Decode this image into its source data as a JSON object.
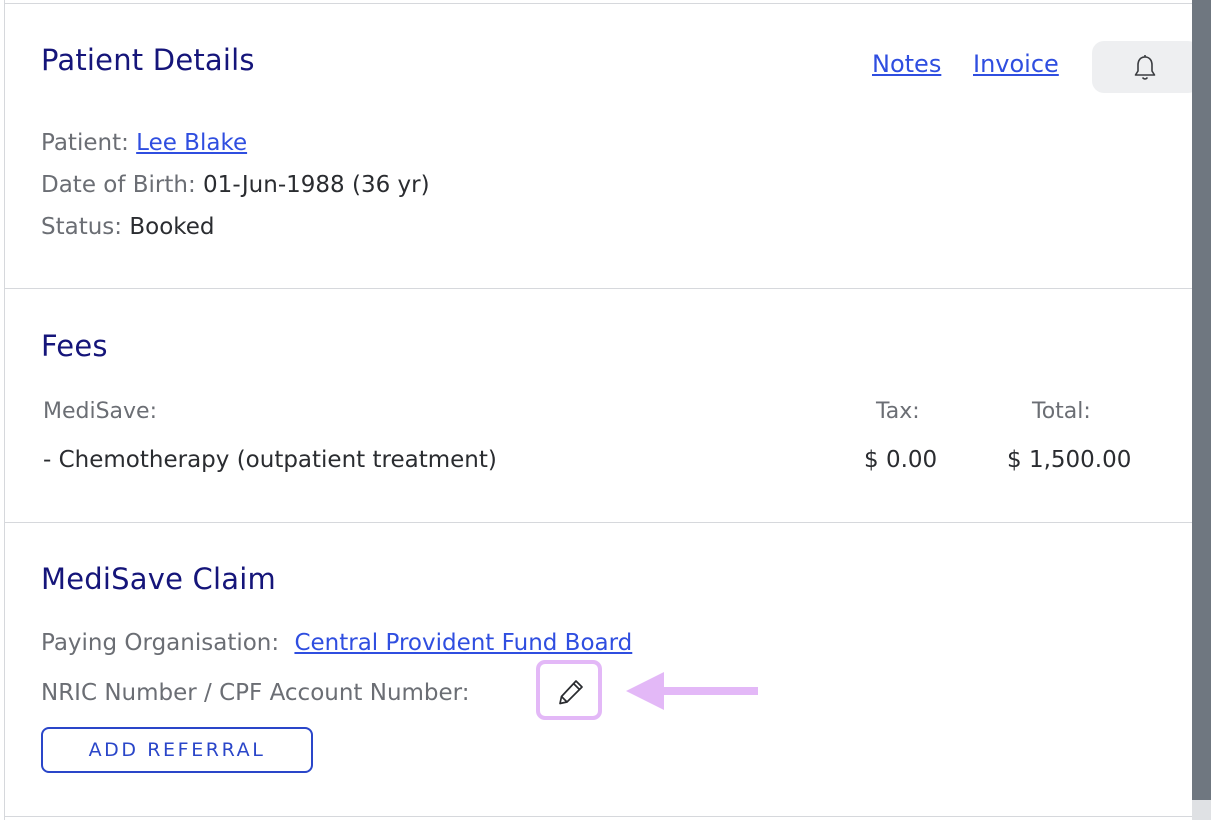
{
  "patient_details": {
    "title": "Patient Details",
    "notes_link": "Notes",
    "invoice_link": "Invoice",
    "bell_icon": "bell-icon",
    "patient_label": "Patient:",
    "patient_name": "Lee Blake",
    "dob_label": "Date of Birth:",
    "dob_value": "01-Jun-1988 (36 yr)",
    "status_label": "Status:",
    "status_value": "Booked"
  },
  "fees": {
    "title": "Fees",
    "category": "MediSave:",
    "tax_header": "Tax:",
    "total_header": "Total:",
    "item_name": "- Chemotherapy (outpatient treatment)",
    "item_tax": "$ 0.00",
    "item_total": "$ 1,500.00"
  },
  "medisave_claim": {
    "title": "MediSave Claim",
    "paying_org_label": "Paying Organisation:",
    "paying_org_value": "Central Provident Fund Board",
    "nric_label": "NRIC Number / CPF Account Number:",
    "edit_icon": "pencil-icon",
    "add_referral_label": "ADD REFERRAL"
  },
  "colors": {
    "heading": "#15157a",
    "link": "#2f4ee0",
    "highlight": "#e3b8f7",
    "scrollbar": "#6f7780"
  }
}
